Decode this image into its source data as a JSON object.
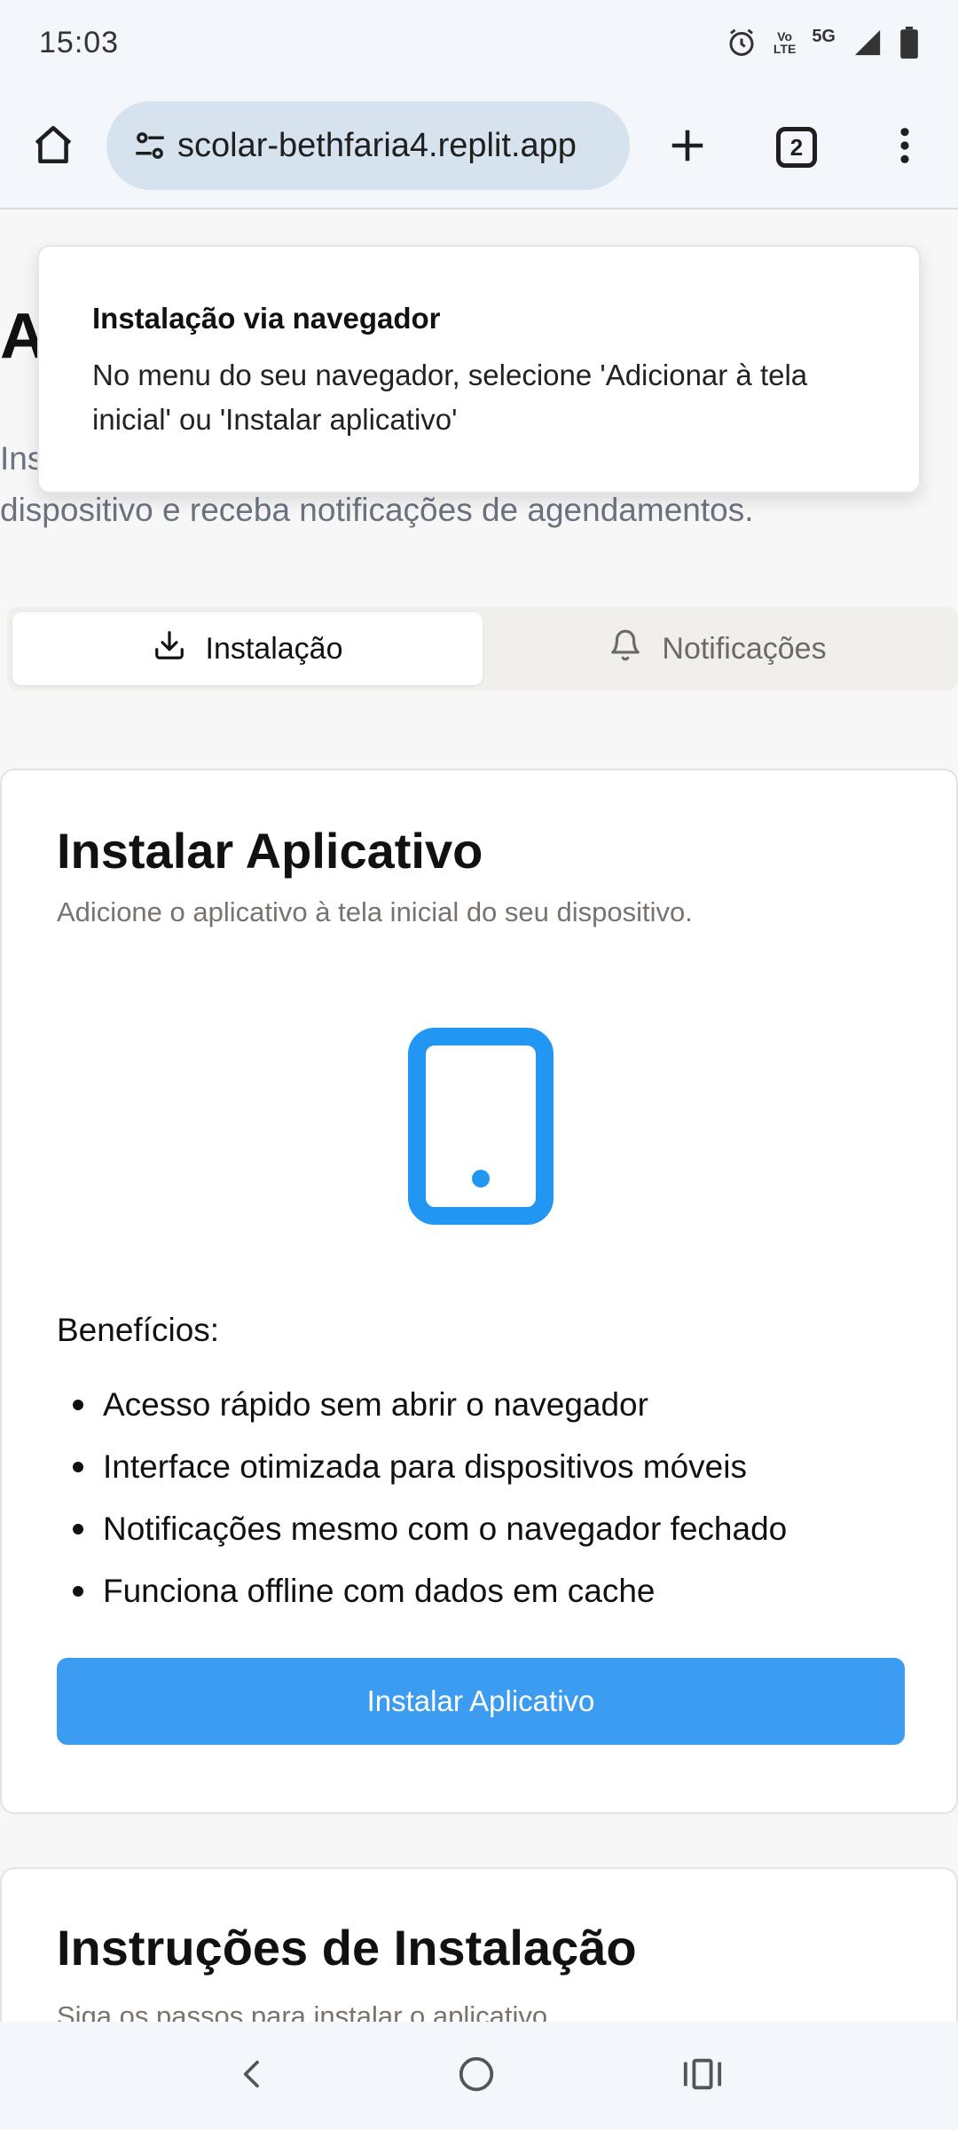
{
  "status_bar": {
    "time": "15:03",
    "network_label": "5G",
    "volte_top": "Vo",
    "volte_bottom": "LTE",
    "icons": [
      "alarm-icon",
      "volte-icon",
      "signal-icon",
      "battery-icon"
    ]
  },
  "browser": {
    "url": "scolar-bethfaria4.replit.app",
    "tab_count": "2",
    "icons": [
      "home-icon",
      "site-settings-icon",
      "new-tab-icon",
      "tab-switcher-icon",
      "overflow-menu-icon"
    ]
  },
  "page": {
    "heading_visible": "A",
    "description_partial_line1": "Ins",
    "description_line2": "dispositivo e receba notificações de agendamentos."
  },
  "toast": {
    "title": "Instalação via navegador",
    "message": "No menu do seu navegador, selecione 'Adicionar à tela inicial' ou 'Instalar aplicativo'"
  },
  "tabs": [
    {
      "label": "Instalação",
      "icon": "download-icon",
      "active": true
    },
    {
      "label": "Notificações",
      "icon": "bell-icon",
      "active": false
    }
  ],
  "install_card": {
    "title": "Instalar Aplicativo",
    "subtitle": "Adicione o aplicativo à tela inicial do seu dispositivo.",
    "illustration_icon": "smartphone-icon",
    "benefits_title": "Benefícios:",
    "benefits": [
      "Acesso rápido sem abrir o navegador",
      "Interface otimizada para dispositivos móveis",
      "Notificações mesmo com o navegador fechado",
      "Funciona offline com dados em cache"
    ],
    "button_label": "Instalar Aplicativo",
    "accent_color": "#3b9cf1"
  },
  "instructions_card": {
    "title": "Instruções de Instalação",
    "subtitle": "Siga os passos para instalar o aplicativo."
  },
  "nav_bar": {
    "icons": [
      "back-icon",
      "home-circle-icon",
      "recents-icon"
    ]
  }
}
